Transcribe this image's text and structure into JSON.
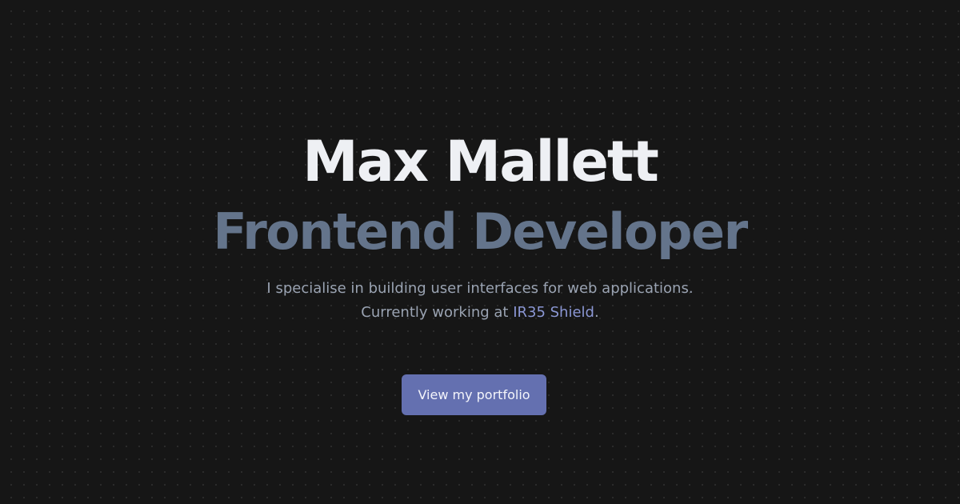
{
  "hero": {
    "name": "Max Mallett",
    "role": "Frontend Developer",
    "tagline_line1": "I specialise in building user interfaces for web applications.",
    "tagline_prefix": "Currently working at ",
    "company_name": "IR35 Shield",
    "tagline_suffix": ".",
    "cta_label": "View my portfolio"
  },
  "colors": {
    "background": "#161616",
    "name": "#eef0f4",
    "role": "#64748b",
    "tagline": "#9aa3b2",
    "link": "#8b97d4",
    "button": "#6470b0"
  }
}
